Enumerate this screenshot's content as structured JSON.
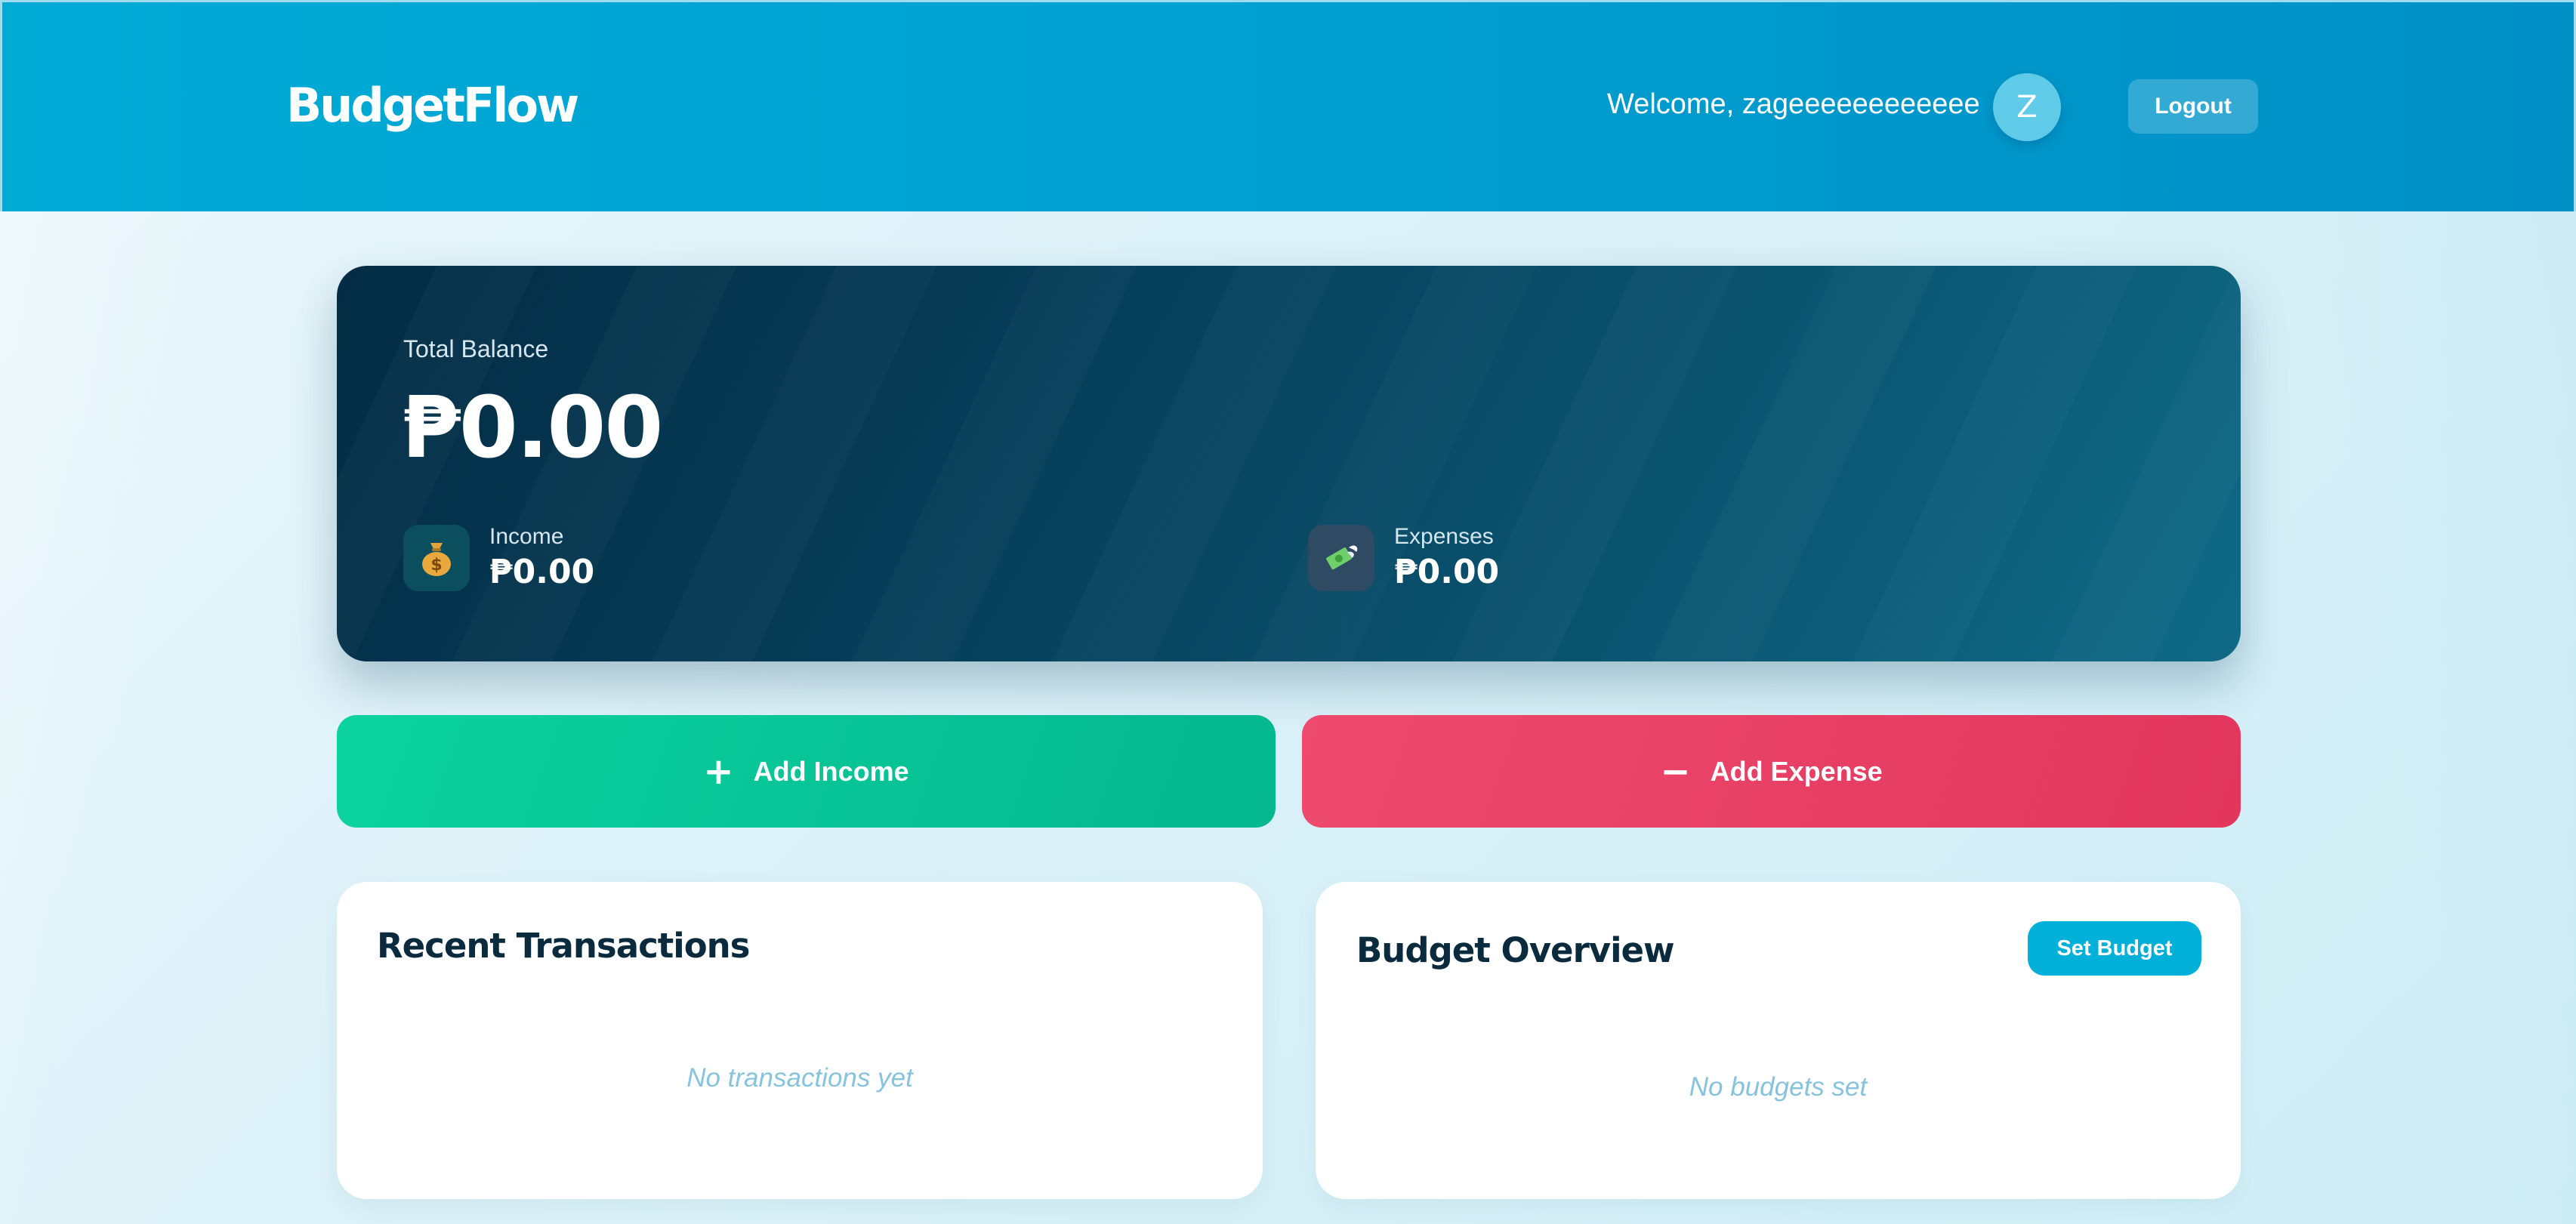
{
  "header": {
    "brand": "BudgetFlow",
    "welcome_text": "Welcome, zageeeeeeeeeeee",
    "avatar_initial": "Z",
    "logout_label": "Logout"
  },
  "balance": {
    "label": "Total Balance",
    "amount": "₱0.00",
    "income": {
      "label": "Income",
      "value": "₱0.00",
      "icon": "money-bag-icon"
    },
    "expenses": {
      "label": "Expenses",
      "value": "₱0.00",
      "icon": "flying-money-icon"
    }
  },
  "actions": {
    "add_income": {
      "symbol": "+",
      "label": "Add Income",
      "color": "#0bcf9c"
    },
    "add_expense": {
      "symbol": "−",
      "label": "Add Expense",
      "color": "#ea4466"
    }
  },
  "recent_transactions": {
    "title": "Recent Transactions",
    "empty_text": "No transactions yet"
  },
  "budget_overview": {
    "title": "Budget Overview",
    "set_budget_label": "Set Budget",
    "empty_text": "No budgets set"
  },
  "colors": {
    "header": "#00a6d4",
    "card_dark": "#063d58",
    "accent": "#00b0d8"
  }
}
